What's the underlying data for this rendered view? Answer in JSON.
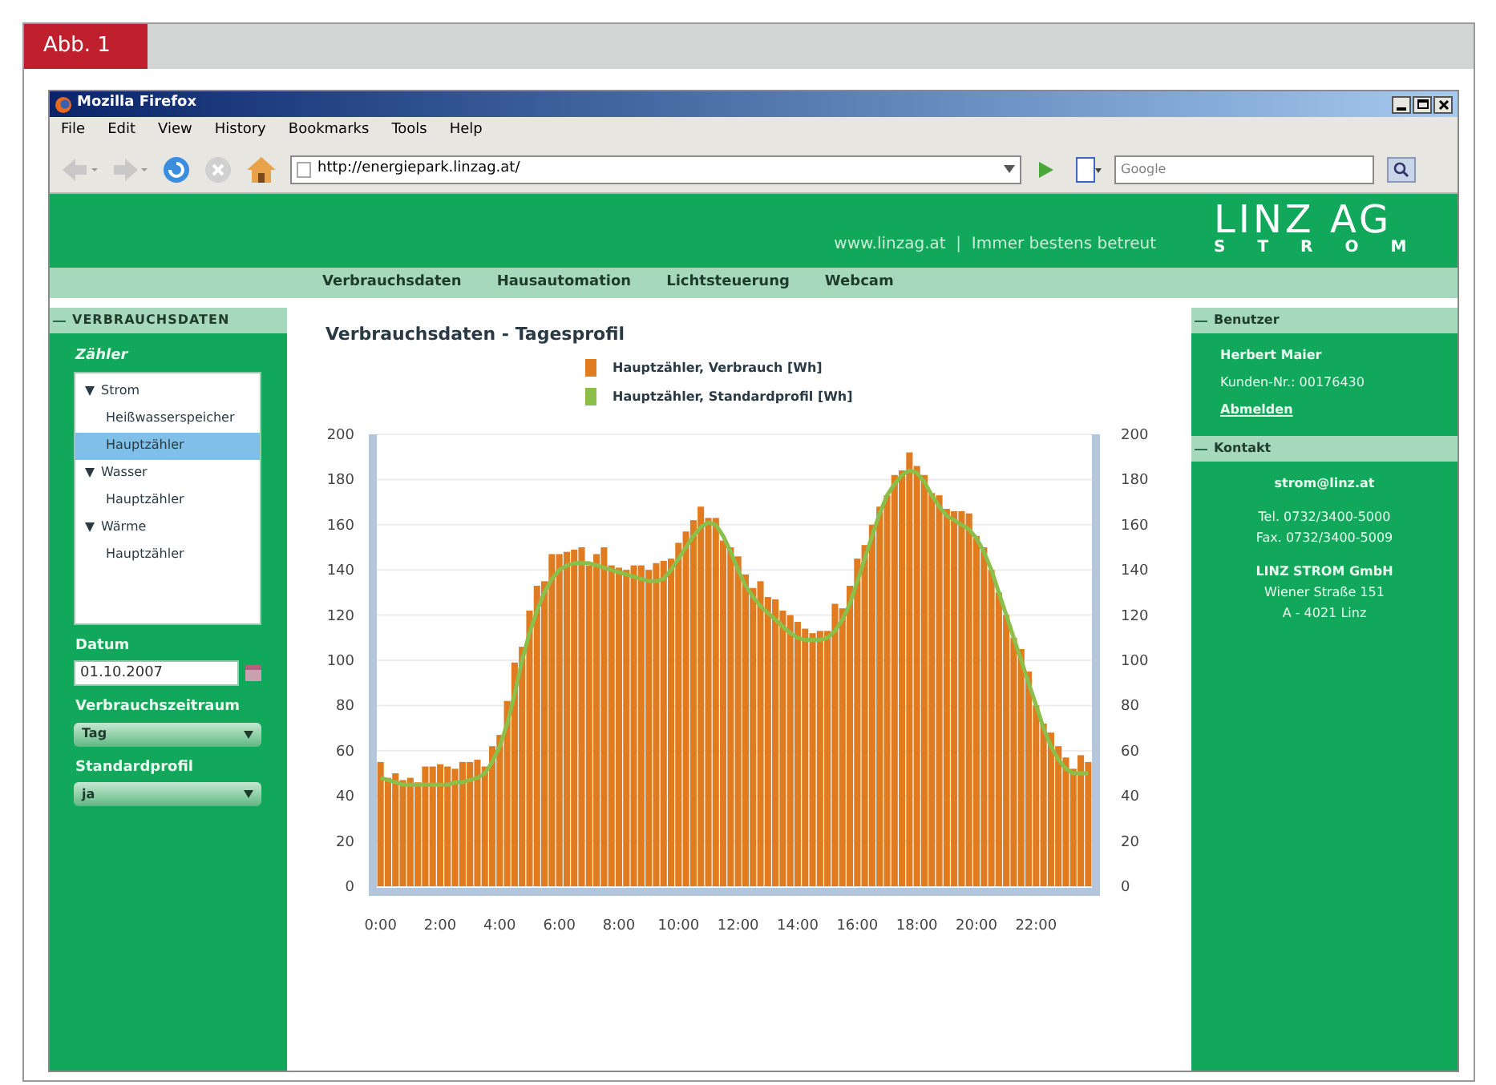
{
  "figure_label": "Abb. 1",
  "window": {
    "title": "Mozilla Firefox"
  },
  "menu": [
    "File",
    "Edit",
    "View",
    "History",
    "Bookmarks",
    "Tools",
    "Help"
  ],
  "toolbar": {
    "url": "http://energiepark.linzag.at/",
    "search_placeholder": "Google"
  },
  "header": {
    "tagline": "www.linzag.at  |  Immer bestens betreut",
    "logo_top": "LINZ AG",
    "logo_bottom": "STROM"
  },
  "nav": [
    "Verbrauchsdaten",
    "Hausautomation",
    "Lichtsteuerung",
    "Webcam"
  ],
  "left_panel": {
    "title": "VERBRAUCHSDATEN",
    "tree_label": "Zähler",
    "tree": [
      {
        "label": "Strom",
        "expanded": true,
        "selected": false,
        "children": [
          {
            "label": "Heißwasserspeicher",
            "selected": false
          },
          {
            "label": "Hauptzähler",
            "selected": true
          }
        ]
      },
      {
        "label": "Wasser",
        "expanded": true,
        "selected": false,
        "children": [
          {
            "label": "Hauptzähler",
            "selected": false
          }
        ]
      },
      {
        "label": "Wärme",
        "expanded": true,
        "selected": false,
        "children": [
          {
            "label": "Hauptzähler",
            "selected": false
          }
        ]
      }
    ],
    "date_label": "Datum",
    "date_value": "01.10.2007",
    "period_label": "Verbrauchszeitraum",
    "period_value": "Tag",
    "profile_label": "Standardprofil",
    "profile_value": "ja"
  },
  "main": {
    "title": "Verbrauchsdaten - Tagesprofil",
    "chart_data": {
      "type": "bar",
      "grid": true,
      "xlim": [
        -0.125,
        23.875
      ],
      "ylim": [
        0,
        200
      ],
      "y2lim": [
        0,
        200
      ],
      "yticks": [
        0,
        20,
        40,
        60,
        80,
        100,
        120,
        140,
        160,
        180,
        200
      ],
      "y2ticks": [
        0,
        20,
        40,
        60,
        80,
        100,
        120,
        140,
        160,
        180,
        200
      ],
      "xticks": [
        {
          "value": 0,
          "label": "0:00"
        },
        {
          "value": 2,
          "label": "2:00"
        },
        {
          "value": 4,
          "label": "4:00"
        },
        {
          "value": 6,
          "label": "6:00"
        },
        {
          "value": 8,
          "label": "8:00"
        },
        {
          "value": 10,
          "label": "10:00"
        },
        {
          "value": 12,
          "label": "12:00"
        },
        {
          "value": 14,
          "label": "14:00"
        },
        {
          "value": 16,
          "label": "16:00"
        },
        {
          "value": 18,
          "label": "18:00"
        },
        {
          "value": 20,
          "label": "20:00"
        },
        {
          "value": 22,
          "label": "22:00"
        }
      ],
      "x": [
        0,
        0.25,
        0.5,
        0.75,
        1,
        1.25,
        1.5,
        1.75,
        2,
        2.25,
        2.5,
        2.75,
        3,
        3.25,
        3.5,
        3.75,
        4,
        4.25,
        4.5,
        4.75,
        5,
        5.25,
        5.5,
        5.75,
        6,
        6.25,
        6.5,
        6.75,
        7,
        7.25,
        7.5,
        7.75,
        8,
        8.25,
        8.5,
        8.75,
        9,
        9.25,
        9.5,
        9.75,
        10,
        10.25,
        10.5,
        10.75,
        11,
        11.25,
        11.5,
        11.75,
        12,
        12.25,
        12.5,
        12.75,
        13,
        13.25,
        13.5,
        13.75,
        14,
        14.25,
        14.5,
        14.75,
        15,
        15.25,
        15.5,
        15.75,
        16,
        16.25,
        16.5,
        16.75,
        17,
        17.25,
        17.5,
        17.75,
        18,
        18.25,
        18.5,
        18.75,
        19,
        19.25,
        19.5,
        19.75,
        20,
        20.25,
        20.5,
        20.75,
        21,
        21.25,
        21.5,
        21.75,
        22,
        22.25,
        22.5,
        22.75,
        23,
        23.25,
        23.5,
        23.75
      ],
      "series": [
        {
          "name": "Hauptzähler, Verbrauch [Wh]",
          "color": "#e07b20",
          "values": [
            55,
            48,
            50,
            47,
            48,
            46,
            53,
            53,
            54,
            53,
            52,
            55,
            55,
            56,
            53,
            62,
            67,
            82,
            99,
            106,
            122,
            133,
            135,
            147,
            147,
            148,
            149,
            150,
            142,
            147,
            150,
            142,
            141,
            140,
            142,
            142,
            140,
            143,
            144,
            145,
            152,
            157,
            162,
            168,
            163,
            163,
            153,
            150,
            146,
            138,
            132,
            135,
            128,
            127,
            122,
            120,
            117,
            114,
            112,
            113,
            113,
            125,
            123,
            133,
            145,
            151,
            160,
            168,
            173,
            182,
            184,
            192,
            186,
            182,
            174,
            173,
            167,
            166,
            166,
            165,
            155,
            150,
            140,
            130,
            120,
            110,
            105,
            95,
            80,
            72,
            68,
            62,
            57,
            52,
            58,
            55
          ]
        },
        {
          "name": "Hauptzähler, Standardprofil [Wh]",
          "color": "#8cbf4a",
          "type": "line",
          "values": [
            48,
            47,
            46,
            45,
            45,
            45,
            45,
            45,
            45,
            45,
            46,
            46,
            47,
            48,
            50,
            55,
            62,
            72,
            85,
            100,
            112,
            122,
            130,
            136,
            140,
            142,
            143,
            143,
            143,
            142,
            141,
            140,
            139,
            138,
            137,
            136,
            135,
            135,
            136,
            140,
            145,
            150,
            155,
            159,
            161,
            160,
            155,
            148,
            140,
            133,
            128,
            124,
            121,
            118,
            115,
            112,
            110,
            109,
            109,
            109,
            110,
            113,
            118,
            125,
            135,
            145,
            155,
            165,
            173,
            178,
            182,
            184,
            183,
            179,
            173,
            168,
            164,
            162,
            160,
            158,
            154,
            148,
            140,
            130,
            120,
            110,
            100,
            90,
            80,
            70,
            62,
            56,
            52,
            50,
            50,
            50
          ]
        }
      ]
    }
  },
  "user_panel": {
    "title": "Benutzer",
    "name": "Herbert Maier",
    "customer_no": "Kunden-Nr.: 00176430",
    "logout": "Abmelden"
  },
  "contact_panel": {
    "title": "Kontakt",
    "email": "strom@linz.at",
    "phone": "Tel. 0732/3400-5000",
    "fax": "Fax. 0732/3400-5009",
    "company": "LINZ STROM GmbH",
    "street": "Wiener Straße 151",
    "city": "A - 4021 Linz"
  }
}
